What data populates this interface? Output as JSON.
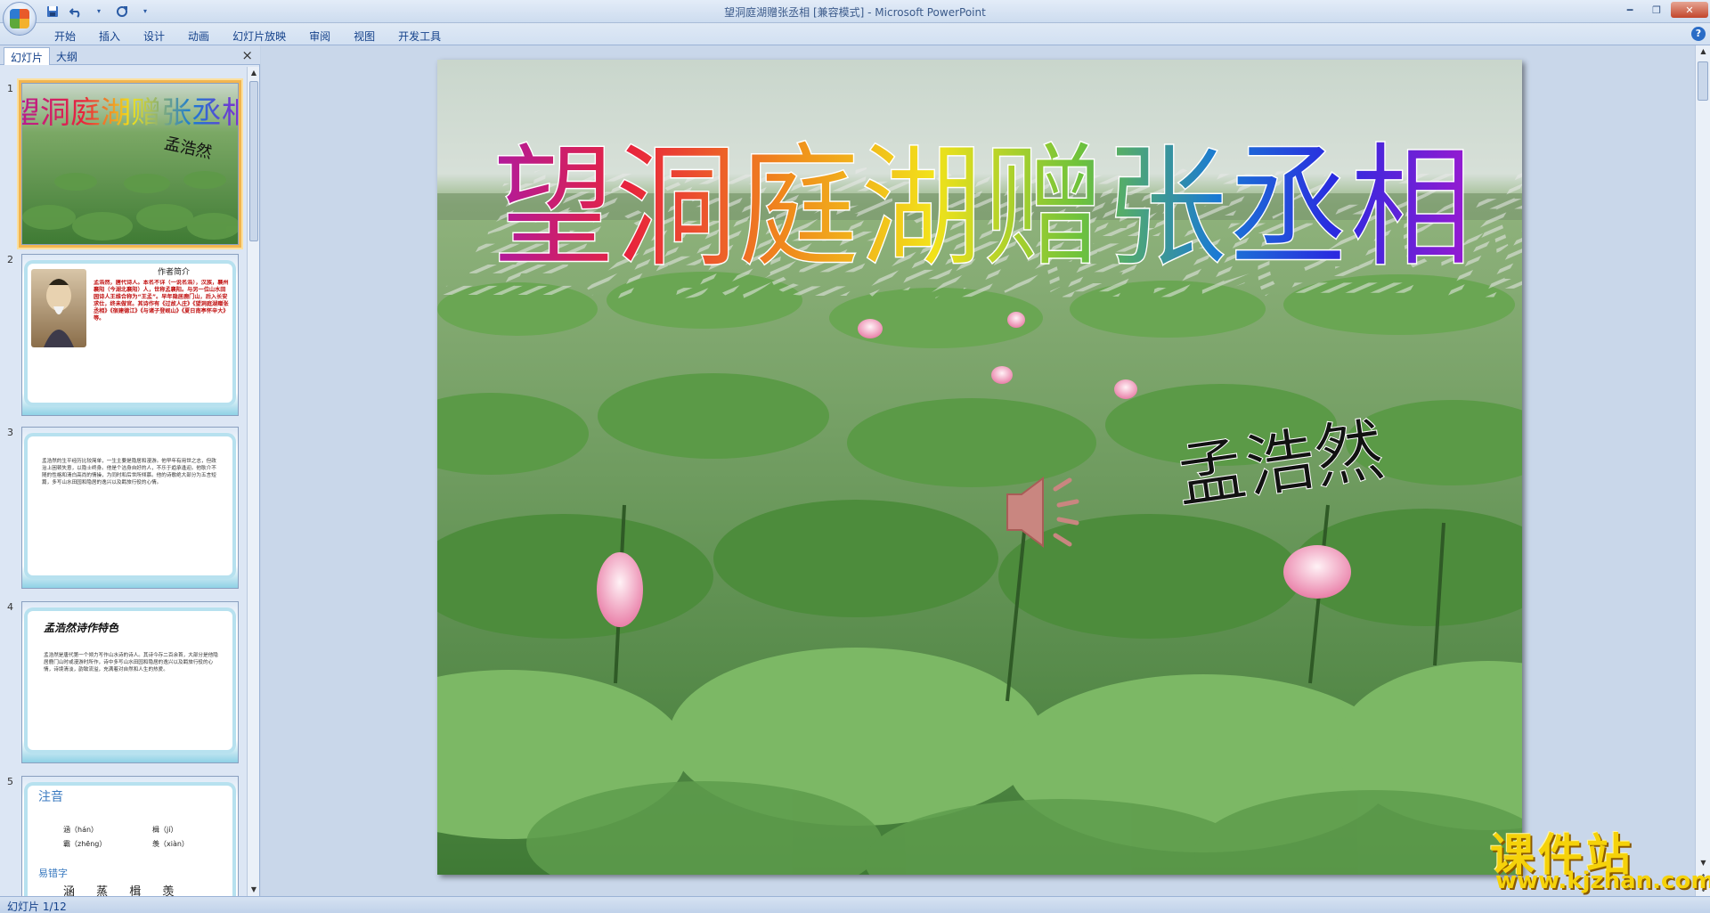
{
  "window": {
    "title": "望洞庭湖赠张丞相 [兼容模式] - Microsoft PowerPoint"
  },
  "quick_access": {
    "save_icon": "save-icon",
    "undo_icon": "undo-icon",
    "redo_icon": "redo-icon",
    "customize_icon": "customize-icon"
  },
  "ribbon": {
    "tabs": [
      "开始",
      "插入",
      "设计",
      "动画",
      "幻灯片放映",
      "审阅",
      "视图",
      "开发工具"
    ]
  },
  "panel": {
    "tab_slides": "幻灯片",
    "tab_outline": "大纲",
    "close": "×"
  },
  "thumbnails": [
    {
      "num": "1",
      "title": "望洞庭湖赠张丞相",
      "author": "孟浩然"
    },
    {
      "num": "2",
      "heading": "作者简介",
      "body": "孟浩然，唐代诗人。本名不详（一说名浩），汉族，襄州襄阳（今湖北襄阳）人，世称孟襄阳。与另一位山水田园诗人王维合称为“王孟”。早年隐居鹿门山，后入长安求仕，终未做官。其诗作有《过故人庄》《望洞庭湖赠张丞相》《宿建德江》《与诸子登岘山》《夏日南亭怀辛大》等。"
    },
    {
      "num": "3",
      "body": "孟浩然的生平经历比较简单，一生主要是隐居和漫游。他早年有用世之志，但政治上困顿失意，以隐士终身。他是个洁身自好的人，不乐于趋承逢迎。他耿介不随的性格和清白高尚的情操，为同时和后世所倾慕。他的诗歌绝大部分为五言短篇，多写山水田园和隐居的逸兴以及羁旅行役的心情。"
    },
    {
      "num": "4",
      "heading": "孟浩然诗作特色",
      "body": "孟浩然是唐代第一个倾力写作山水诗的诗人。其诗今存二百余首，大部分是他隐居鹿门山时或漫游时所作，诗中多写山水田园和隐居的逸兴以及羁旅行役的心情，诗境清淡，韵致流溢，充满着对自然和人生的热爱。"
    },
    {
      "num": "5",
      "heading": "注音",
      "pinyin_left_1": "涵（hán）",
      "pinyin_right_1": "楫（jí）",
      "pinyin_left_2": "霸（zhēng）",
      "pinyin_right_2": "羡（xiàn）",
      "heading_2": "易错字",
      "chars": "涵  蒸  楫  羡"
    }
  ],
  "slide": {
    "title": "望洞庭湖赠张丞相",
    "author": "孟浩然",
    "sound_icon": "speaker-icon"
  },
  "status": {
    "slide_counter": "幻灯片 1/12"
  },
  "watermark": {
    "brand": "课件站",
    "url": "www.kjzhan.com"
  },
  "colors": {
    "title_gradient": [
      "#b01a9e",
      "#e8243c",
      "#f08a1c",
      "#f2e21a",
      "#6ec23c",
      "#1a7ad4",
      "#2a2ae0",
      "#9a1ad0"
    ],
    "selection": "#f2b54f"
  }
}
